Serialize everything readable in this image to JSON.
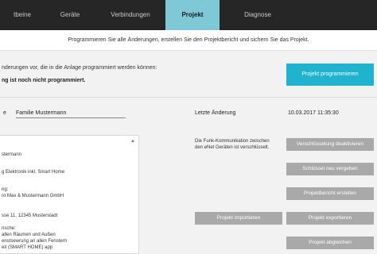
{
  "nav": {
    "tabs": [
      {
        "label": "tbeine"
      },
      {
        "label": "Geräte"
      },
      {
        "label": "Verbindungen"
      },
      {
        "label": "Projekt"
      },
      {
        "label": "Diagnose"
      }
    ]
  },
  "info": {
    "text": "Programmieren Sie alle Änderungen, erstellen Sie den Projektbericht und sichern Sie das Projekt."
  },
  "status": {
    "line1": "nderungen vor, die in die Anlage programmiert werden können:",
    "line2": "ng ist noch nicht programmiert.",
    "program_button": "Projekt programmieren"
  },
  "project": {
    "name_label": "e",
    "name_value": "Familie Mustermann",
    "last_change_label": "Letzte Änderung",
    "last_change_value": "10.03.2017 11:35:30"
  },
  "details": {
    "lines": [
      "stermann",
      "g Elektronik inkl. Smart Home",
      "ng:",
      "ro Max & Mustermann GmbH",
      "sse 11, 12345 Musterstadt",
      "nsche:",
      " allen Räumen und Außen",
      "enstsewrung an allen Fenstern",
      "eit (SMART HOME) app"
    ]
  },
  "funk": {
    "text": "Die Funk-Kommunikation zwischen den eNet Geräten ist verschlüsselt."
  },
  "buttons": {
    "disable_encryption": "Verschlüsselung deaktivieren",
    "new_key": "Schlüssel neu vergeben",
    "create_report": "Projektbericht erstellen",
    "import": "Projekt importieren",
    "export": "Projekt exportieren",
    "sync": "Projekt abgleichen"
  }
}
